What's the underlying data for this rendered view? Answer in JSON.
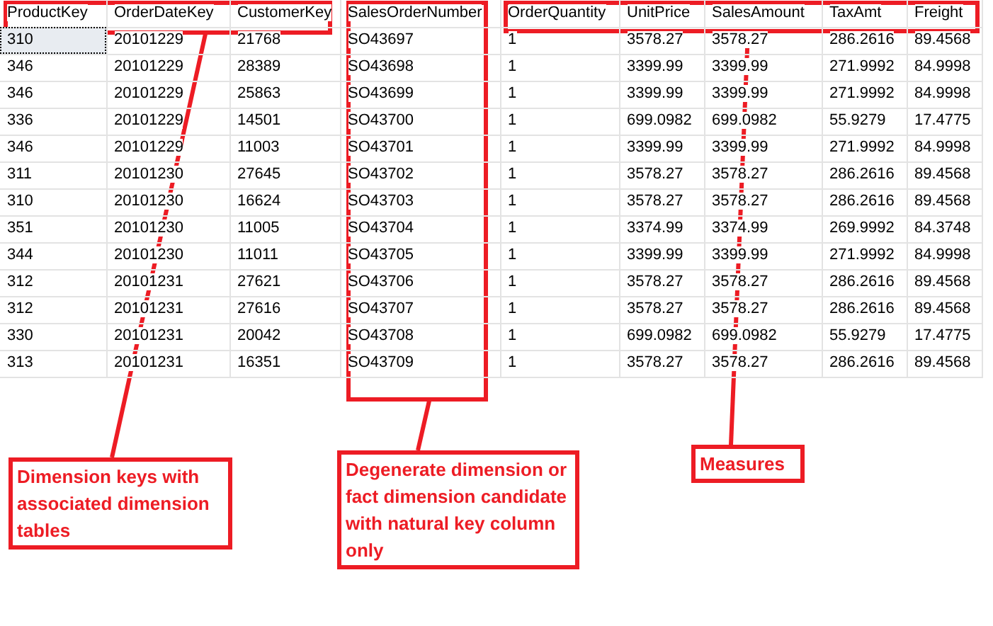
{
  "grid": {
    "columns": [
      "ProductKey",
      "OrderDateKey",
      "CustomerKey",
      "SalesOrderNumber",
      "OrderQuantity",
      "UnitPrice",
      "SalesAmount",
      "TaxAmt",
      "Freight"
    ],
    "rows": [
      {
        "selected": true,
        "cells": [
          "310",
          "20101229",
          "21768",
          "SO43697",
          "1",
          "3578.27",
          "3578.27",
          "286.2616",
          "89.4568"
        ]
      },
      {
        "selected": false,
        "cells": [
          "346",
          "20101229",
          "28389",
          "SO43698",
          "1",
          "3399.99",
          "3399.99",
          "271.9992",
          "84.9998"
        ]
      },
      {
        "selected": false,
        "cells": [
          "346",
          "20101229",
          "25863",
          "SO43699",
          "1",
          "3399.99",
          "3399.99",
          "271.9992",
          "84.9998"
        ]
      },
      {
        "selected": false,
        "cells": [
          "336",
          "20101229",
          "14501",
          "SO43700",
          "1",
          "699.0982",
          "699.0982",
          "55.9279",
          "17.4775"
        ]
      },
      {
        "selected": false,
        "cells": [
          "346",
          "20101229",
          "11003",
          "SO43701",
          "1",
          "3399.99",
          "3399.99",
          "271.9992",
          "84.9998"
        ]
      },
      {
        "selected": false,
        "cells": [
          "311",
          "20101230",
          "27645",
          "SO43702",
          "1",
          "3578.27",
          "3578.27",
          "286.2616",
          "89.4568"
        ]
      },
      {
        "selected": false,
        "cells": [
          "310",
          "20101230",
          "16624",
          "SO43703",
          "1",
          "3578.27",
          "3578.27",
          "286.2616",
          "89.4568"
        ]
      },
      {
        "selected": false,
        "cells": [
          "351",
          "20101230",
          "11005",
          "SO43704",
          "1",
          "3374.99",
          "3374.99",
          "269.9992",
          "84.3748"
        ]
      },
      {
        "selected": false,
        "cells": [
          "344",
          "20101230",
          "11011",
          "SO43705",
          "1",
          "3399.99",
          "3399.99",
          "271.9992",
          "84.9998"
        ]
      },
      {
        "selected": false,
        "cells": [
          "312",
          "20101231",
          "27621",
          "SO43706",
          "1",
          "3578.27",
          "3578.27",
          "286.2616",
          "89.4568"
        ]
      },
      {
        "selected": false,
        "cells": [
          "312",
          "20101231",
          "27616",
          "SO43707",
          "1",
          "3578.27",
          "3578.27",
          "286.2616",
          "89.4568"
        ]
      },
      {
        "selected": false,
        "cells": [
          "330",
          "20101231",
          "20042",
          "SO43708",
          "1",
          "699.0982",
          "699.0982",
          "55.9279",
          "17.4775"
        ]
      },
      {
        "selected": false,
        "cells": [
          "313",
          "20101231",
          "16351",
          "SO43709",
          "1",
          "3578.27",
          "3578.27",
          "286.2616",
          "89.4568"
        ]
      }
    ]
  },
  "callouts": [
    {
      "text": "Dimension keys with associated dimension tables"
    },
    {
      "text": "Degenerate dimension or fact dimension candidate with natural key column only"
    },
    {
      "text": "Measures"
    }
  ]
}
